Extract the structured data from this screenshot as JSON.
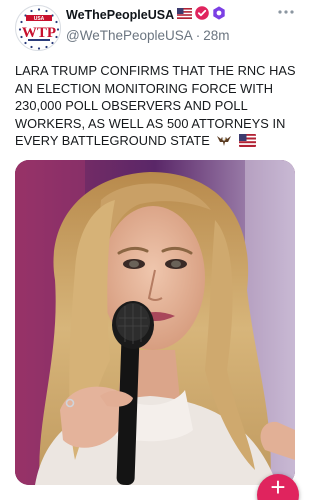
{
  "account": {
    "display_name": "WeThePeopleUSA",
    "handle": "@WeThePeopleUSA",
    "separator": "·",
    "time_ago": "28m",
    "avatar_text": "WTP",
    "avatar_small_text": "USA",
    "badges": [
      "us-flag-icon",
      "verified-badge-icon",
      "org-badge-icon"
    ]
  },
  "tweet": {
    "text": "LARA TRUMP CONFIRMS THAT THE RNC HAS AN ELECTION MONITORING FORCE WITH 230,000 POLL OBSERVERS AND POLL WORKERS, AS WELL AS 500 ATTORNEYS IN EVERY BATTLEGROUND STATE",
    "trailing_emojis": [
      "eagle-icon",
      "us-flag-icon"
    ]
  },
  "media": {
    "subject": "photo of a woman with long blonde hair speaking into a black microphone",
    "background_colors": [
      "#7a2b5f",
      "#4a2a6e",
      "#d8c9a8"
    ]
  },
  "compose": {
    "icon": "plus-icon",
    "label": "+",
    "color": "#e0245e"
  },
  "colors": {
    "name": "#0f1419",
    "meta": "#6b7580",
    "verified": "#e0245e",
    "org_badge": "#7b3fe4"
  }
}
